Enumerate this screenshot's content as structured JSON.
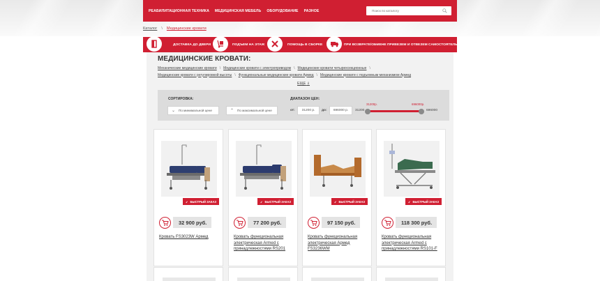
{
  "nav": {
    "items": [
      "РЕАБИЛИТАЦИОННАЯ ТЕХНИКА",
      "МЕДИЦИНСКАЯ МЕБЕЛЬ",
      "ОБОРУДОВАНИЕ",
      "РАЗНОЕ"
    ],
    "search_placeholder": "Поиск по каталогу"
  },
  "breadcrumb": {
    "catalog": "Каталог",
    "separator": "\\",
    "current": "Медицинские кровати"
  },
  "features": [
    {
      "label": "ДОСТАВКА ДО ДВЕРИ",
      "icon": "door-icon"
    },
    {
      "label": "ПОДЪЕМ НА ЭТАЖ",
      "icon": "hand-truck-icon"
    },
    {
      "label": "ПОМОЩЬ В СБОРКЕ",
      "icon": "tools-icon"
    },
    {
      "label": "ПРИ ВОЗВРАТЕ/ОБМЕНЕ ПРИВЕЗЕМ И ОТВЕЗЕМ САМОСТОЯТЕЛЬНО",
      "icon": "truck-icon"
    }
  ],
  "page_title": "МЕДИЦИНСКИЕ КРОВАТИ:",
  "subcategories": [
    "Механические медицинские кровати",
    "Медицинские кровати с электроприводом",
    "Медицинские кровати четырехсекционные",
    "Медицинские кровати с регулировкой высоты",
    "Функциональные медицинские кровати Армед",
    "Медицинские кровати с подъемным механизмом Армед"
  ],
  "more_link": "ЕЩЕ",
  "filter": {
    "sort_label": "СОРТИРОВКА:",
    "sort_min": "По минимальной цене",
    "sort_max": "По максимальной цене",
    "range_label": "ДИАПАЗОН ЦЕН:",
    "from_label": "от:",
    "from_value": "31200 р.",
    "to_label": "до:",
    "to_value": "696000 р.",
    "slider_min": "31200",
    "slider_max": "696000",
    "slider_low_label": "31200р.",
    "slider_high_label": "696000р."
  },
  "fast_order_label": "БЫСТРЫЙ ЗАКАЗ",
  "products": [
    {
      "price": "32 900 руб.",
      "name": "Кровать FS3023W Армед",
      "frame": "#6b6b6b",
      "mattress": "#2e3f70",
      "color": "#7b7b7b"
    },
    {
      "price": "77 200 руб.",
      "name": "Кровать функциональная электрическая Armed с принадлежностями RS201",
      "frame": "#6b6b6b",
      "mattress": "#2c3b6e",
      "color": "#7b7b7b"
    },
    {
      "price": "97 150 руб.",
      "name": "Кровать функциональная электрическая Армед FS3236WM",
      "frame": "#b36a2c",
      "mattress": "#c88a4a",
      "color": "#7b7b7b"
    },
    {
      "price": "118 300 руб.",
      "name": "Кровать функциональная электрическая Armed с принадлежностями RS101-F",
      "frame": "#8a8a8a",
      "mattress": "#3b6b4f",
      "color": "#7b7b7b"
    }
  ],
  "colors": {
    "brand": "#d01f32",
    "panel": "#f2f2f2",
    "filter_bg": "#dcdcdc",
    "price_bg": "#e4e4e4"
  }
}
